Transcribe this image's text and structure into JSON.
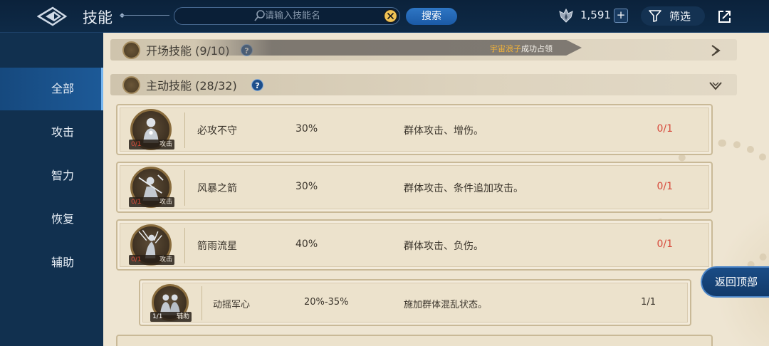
{
  "header": {
    "title": "技能",
    "search_placeholder": "请输入技能名",
    "search_button": "搜索",
    "currency_value": "1,591",
    "plus_label": "+",
    "filter_label": "筛选"
  },
  "sidebar": {
    "items": [
      {
        "label": "全部",
        "active": true
      },
      {
        "label": "攻击",
        "active": false
      },
      {
        "label": "智力",
        "active": false
      },
      {
        "label": "恢复",
        "active": false
      },
      {
        "label": "辅助",
        "active": false
      }
    ]
  },
  "categories": [
    {
      "label": "开场技能 (9/10)",
      "help": "?"
    },
    {
      "label": "主动技能 (28/32)",
      "help": "?"
    }
  ],
  "banner": {
    "player_name": "宇宙浪子",
    "message": "成功占领"
  },
  "skills": [
    {
      "name": "必攻不守",
      "rate": "30%",
      "desc": "群体攻击、增伤。",
      "count": "0/1",
      "tag_count": "0/1",
      "tag_type": "攻击"
    },
    {
      "name": "风暴之箭",
      "rate": "30%",
      "desc": "群体攻击、条件追加攻击。",
      "count": "0/1",
      "tag_count": "0/1",
      "tag_type": "攻击"
    },
    {
      "name": "箭雨流星",
      "rate": "40%",
      "desc": "群体攻击、负伤。",
      "count": "0/1",
      "tag_count": "0/1",
      "tag_type": "攻击"
    },
    {
      "name": "动摇军心",
      "rate": "20%-35%",
      "desc": "施加群体混乱状态。",
      "count": "1/1",
      "tag_count": "1/1",
      "tag_type": "辅助"
    }
  ],
  "back_to_top": "返回顶部",
  "colors": {
    "accent": "#1b5aa6",
    "count_red": "#d7493b",
    "parchment": "#efe6d3",
    "sidebar": "#11304f"
  }
}
